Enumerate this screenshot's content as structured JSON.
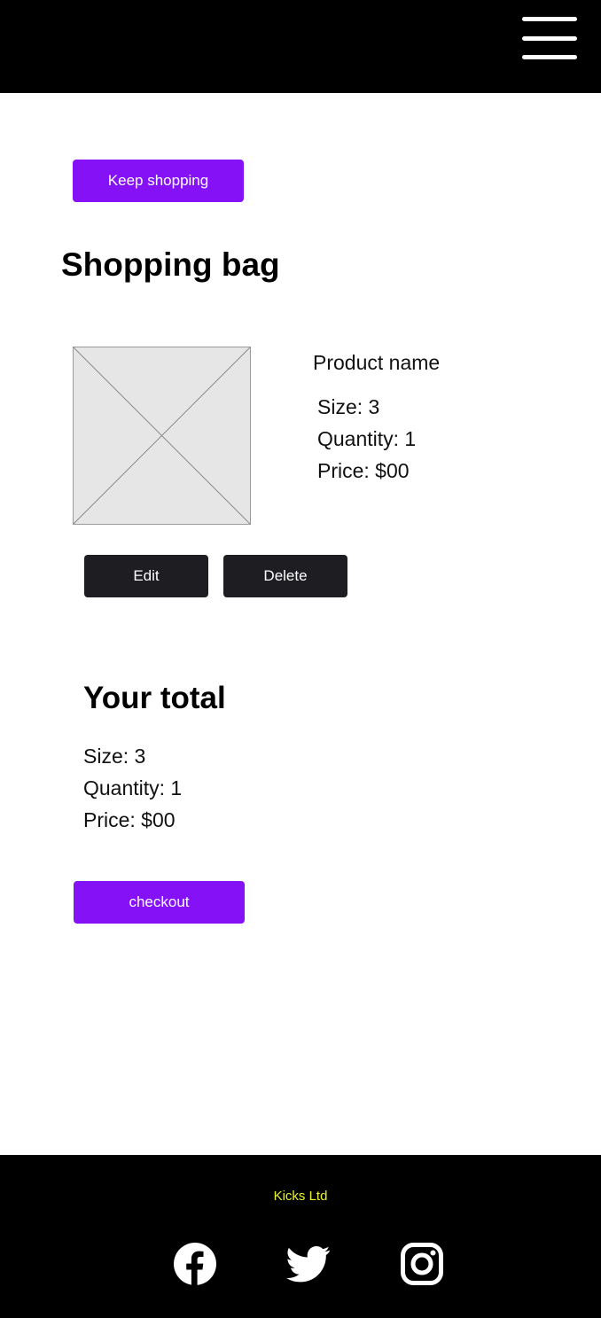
{
  "colors": {
    "accent": "#8512f7",
    "brand": "#e8f22c",
    "header_bg": "#000000",
    "dark_button": "#1e1d22"
  },
  "header": {
    "menu_icon": "hamburger-menu-icon"
  },
  "actions": {
    "keep_shopping_label": "Keep shopping"
  },
  "bag": {
    "title": "Shopping bag",
    "item": {
      "image_icon": "image-placeholder-icon",
      "name": "Product name",
      "size": "Size: 3",
      "quantity": "Quantity: 1",
      "price": "Price: $00",
      "edit_label": "Edit",
      "delete_label": "Delete"
    }
  },
  "total": {
    "title": "Your total",
    "size": "Size: 3",
    "quantity": "Quantity: 1",
    "price": "Price: $00",
    "checkout_label": "checkout"
  },
  "footer": {
    "brand": "Kicks Ltd",
    "social": [
      "facebook-icon",
      "twitter-icon",
      "instagram-icon"
    ]
  }
}
